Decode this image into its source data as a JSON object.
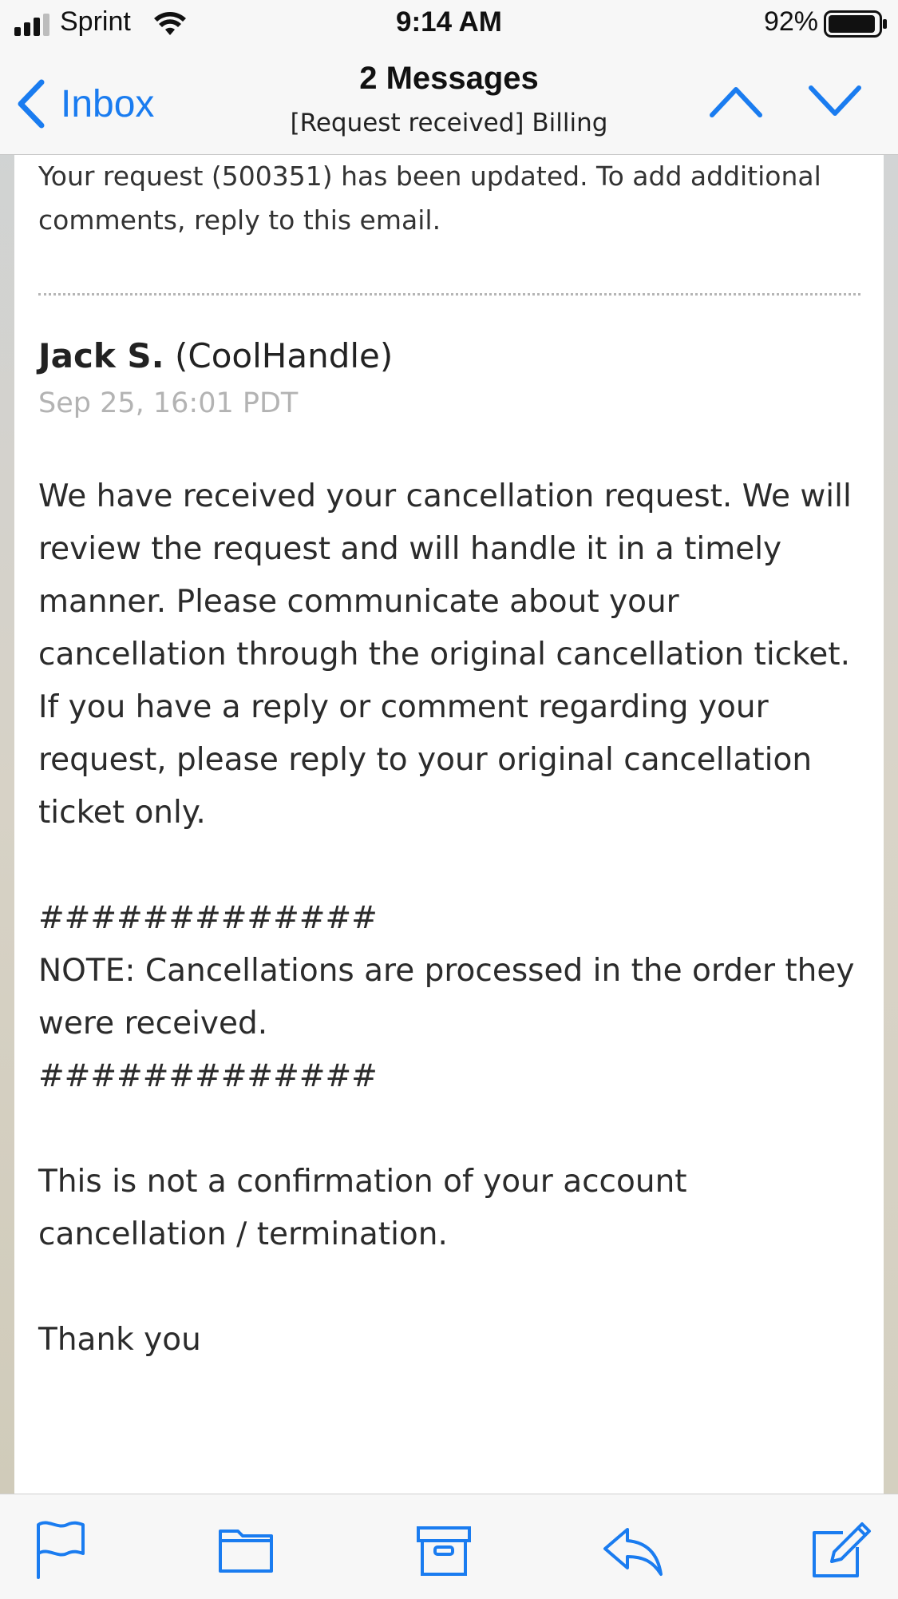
{
  "status_bar": {
    "carrier": "Sprint",
    "time": "9:14 AM",
    "battery_percent": "92%"
  },
  "nav_bar": {
    "back_label": "Inbox",
    "title": "2 Messages",
    "subtitle": "[Request received] Billing"
  },
  "message": {
    "previous_text": "Your request (500351) has been updated. To add additional comments, reply to this email.",
    "sender_name": "Jack S.",
    "sender_handle": "(CoolHandle)",
    "timestamp": "Sep 25, 16:01 PDT",
    "paragraph_1": "We have received your cancellation request. We will review the request and will handle it in a timely manner. Please communicate about your cancellation through the original cancellation ticket. If you have a reply or comment regarding your request, please reply to your original cancellation ticket only.",
    "hash_line_1": "#############",
    "note": "NOTE: Cancellations are processed in the order they were received.",
    "hash_line_2": "#############",
    "paragraph_2": "This is not a confirmation of your account cancellation / termination.",
    "closing": "Thank you"
  },
  "toolbar": {
    "icons": [
      "flag-icon",
      "folder-icon",
      "archive-icon",
      "reply-icon",
      "compose-icon"
    ]
  },
  "colors": {
    "accent": "#1a7cf0",
    "timestamp": "#b3b3b3",
    "bar_background": "#f7f7f7"
  }
}
